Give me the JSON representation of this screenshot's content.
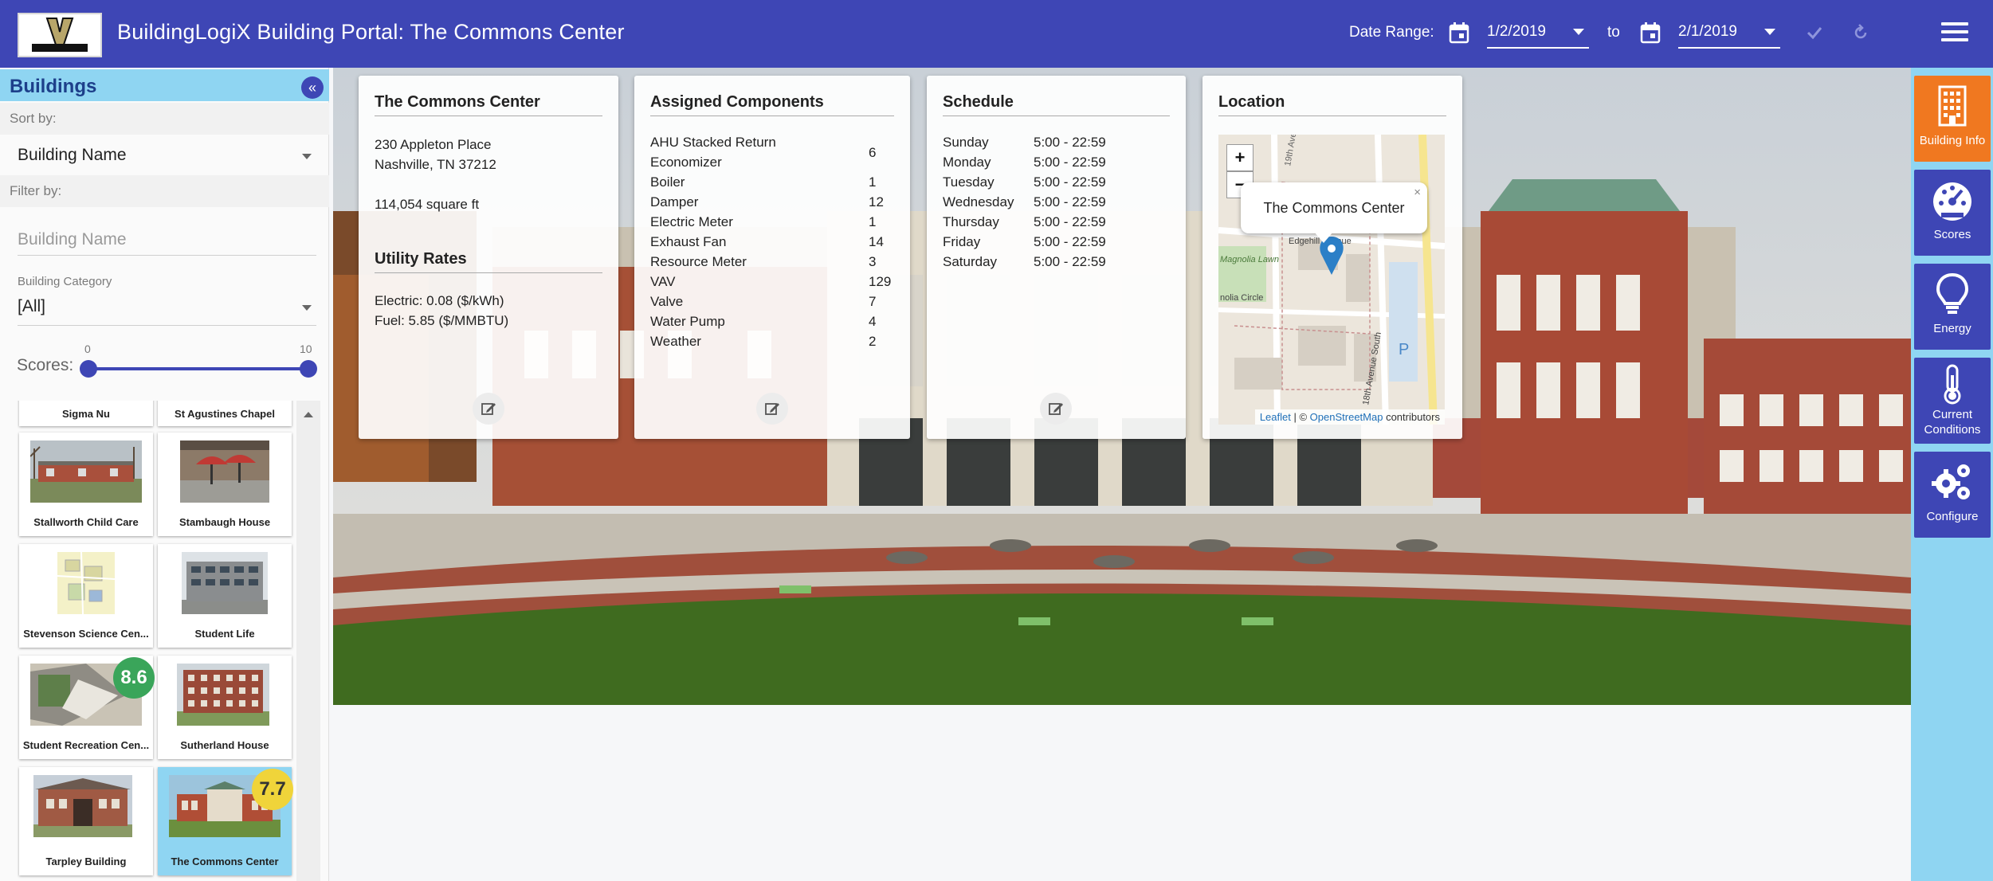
{
  "header": {
    "logo_text": "VANDERBILT",
    "title": "BuildingLogiX Building Portal: The Commons Center",
    "date_range_label": "Date Range:",
    "start_date": "1/2/2019",
    "to_label": "to",
    "end_date": "2/1/2019",
    "apply_icon": "check-icon",
    "reset_icon": "refresh-icon",
    "menu_icon": "hamburger-menu-icon"
  },
  "sidebar": {
    "title": "Buildings",
    "sort_by_label": "Sort by:",
    "sort_by_value": "Building Name",
    "filter_by_label": "Filter by:",
    "name_placeholder": "Building Name",
    "category_label": "Building Category",
    "category_value": "[All]",
    "scores_label": "Scores:",
    "scores_min": "0",
    "scores_max": "10",
    "buildings": [
      {
        "name": "Sigma Nu"
      },
      {
        "name": "St Agustines Chapel"
      },
      {
        "name": "Stallworth Child Care"
      },
      {
        "name": "Stambaugh House"
      },
      {
        "name": "Stevenson Science Cen..."
      },
      {
        "name": "Student Life"
      },
      {
        "name": "Student Recreation Cen...",
        "score": "8.6"
      },
      {
        "name": "Sutherland House"
      },
      {
        "name": "Tarpley Building"
      },
      {
        "name": "The Commons Center",
        "score": "7.7",
        "selected": true
      }
    ]
  },
  "building_card": {
    "title": "The Commons Center",
    "address_line1": "230 Appleton Place",
    "address_line2": "Nashville, TN 37212",
    "area": "114,054 square ft",
    "utility_title": "Utility Rates",
    "electric_rate": "Electric: 0.08 ($/kWh)",
    "fuel_rate": "Fuel: 5.85 ($/MMBTU)"
  },
  "components_card": {
    "title": "Assigned Components",
    "items": [
      {
        "name": "AHU Stacked Return",
        "count": "6"
      },
      {
        "name": "Economizer",
        "count": ""
      },
      {
        "name": "Boiler",
        "count": "1"
      },
      {
        "name": "Damper",
        "count": "12"
      },
      {
        "name": "Electric Meter",
        "count": "1"
      },
      {
        "name": "Exhaust Fan",
        "count": "14"
      },
      {
        "name": "Resource Meter",
        "count": "3"
      },
      {
        "name": "VAV",
        "count": "129"
      },
      {
        "name": "Valve",
        "count": "7"
      },
      {
        "name": "Water Pump",
        "count": "4"
      },
      {
        "name": "Weather",
        "count": "2"
      }
    ]
  },
  "schedule_card": {
    "title": "Schedule",
    "days": [
      {
        "day": "Sunday",
        "hours": "5:00 - 22:59"
      },
      {
        "day": "Monday",
        "hours": "5:00 - 22:59"
      },
      {
        "day": "Tuesday",
        "hours": "5:00 - 22:59"
      },
      {
        "day": "Wednesday",
        "hours": "5:00 - 22:59"
      },
      {
        "day": "Thursday",
        "hours": "5:00 - 22:59"
      },
      {
        "day": "Friday",
        "hours": "5:00 - 22:59"
      },
      {
        "day": "Saturday",
        "hours": "5:00 - 22:59"
      }
    ]
  },
  "location_card": {
    "title": "Location",
    "zoom_in": "+",
    "zoom_out": "−",
    "popup_text": "The Commons Center",
    "popup_close": "×",
    "map_labels": [
      "19th Ave",
      "Edgehill Avenue",
      "Magnolia Lawn",
      "nolia Circle",
      "18th Avenue South",
      "P"
    ],
    "attribution_leaflet": "Leaflet",
    "attribution_sep": " | © ",
    "attribution_osm": "OpenStreetMap",
    "attribution_suffix": " contributors"
  },
  "rail": [
    {
      "label": "Building Info",
      "icon": "building-icon",
      "active": true
    },
    {
      "label": "Scores",
      "icon": "gauge-icon"
    },
    {
      "label": "Energy",
      "icon": "lightbulb-icon"
    },
    {
      "label": "Current Conditions",
      "icon": "thermometer-icon"
    },
    {
      "label": "Configure",
      "icon": "gears-icon"
    }
  ],
  "colors": {
    "primary": "#3e46b5",
    "accent_light": "#8fd5f2",
    "active_orange": "#f07820",
    "score_green": "#3aa55a",
    "score_yellow": "#f0d43a"
  }
}
